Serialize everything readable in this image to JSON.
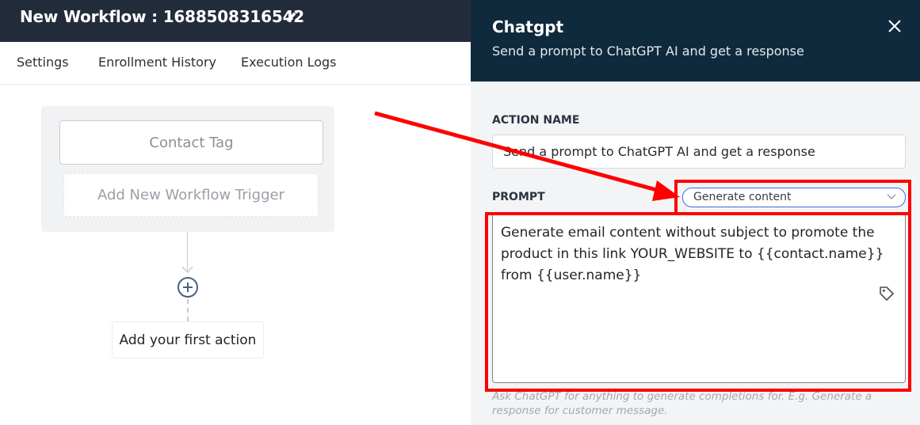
{
  "header": {
    "title": "New Workflow : 1688508316542",
    "edit_icon": "pencil-icon"
  },
  "tabs": [
    {
      "label": "Settings"
    },
    {
      "label": "Enrollment History"
    },
    {
      "label": "Execution Logs"
    }
  ],
  "canvas": {
    "trigger_label": "Contact Tag",
    "add_trigger_label": "Add New Workflow Trigger",
    "add_action_icon": "plus-circle-icon",
    "first_action_label": "Add your first action"
  },
  "panel": {
    "title": "Chatgpt",
    "subtitle": "Send a prompt to ChatGPT AI and get a response",
    "close_icon": "close-icon",
    "action_name_label": "ACTION NAME",
    "action_name_value": "Send a prompt to ChatGPT AI and get a response",
    "prompt_label": "PROMPT",
    "prompt_type_selected": "Generate content",
    "prompt_text": "Generate email content without subject to promote the product in this link YOUR_WEBSITE to {{contact.name}} from {{user.name}}",
    "tag_icon": "tag-icon",
    "help_text": "Ask ChatGPT for anything to generate completions for. E.g. Generate a response for customer message."
  },
  "annotation": {
    "color": "#ff0000",
    "arrow_icon": "red-arrow"
  },
  "colors": {
    "topbar": "#232c3b",
    "panel_header": "#0f2a3c",
    "select_border": "#3b6fd9"
  }
}
